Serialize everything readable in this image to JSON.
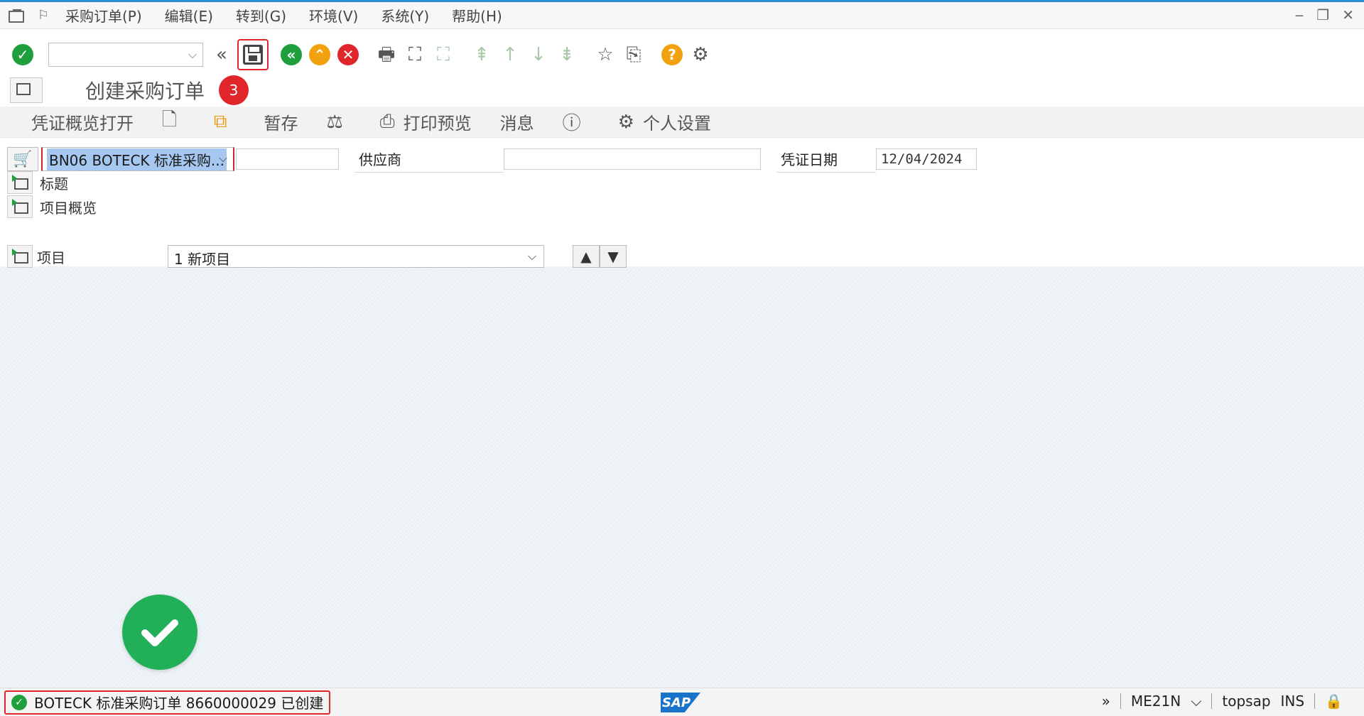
{
  "menu": {
    "items": [
      "采购订单(P)",
      "编辑(E)",
      "转到(G)",
      "环境(V)",
      "系统(Y)",
      "帮助(H)"
    ]
  },
  "title": {
    "text": "创建采购订单",
    "step_badge": "3"
  },
  "app_toolbar": {
    "doc_overview": "凭证概览打开",
    "hold": "暂存",
    "print_preview": "打印预览",
    "messages": "消息",
    "personal_settings": "个人设置"
  },
  "header": {
    "doc_type": "BN06 BOTECK 标准采购...",
    "vendor_label": "供应商",
    "vendor_value": "",
    "doc_date_label": "凭证日期",
    "doc_date_value": "12/04/2024"
  },
  "sections": {
    "header_label": "标题",
    "item_overview_label": "项目概览",
    "item_label": "项目",
    "item_value": "1 新项目"
  },
  "status": {
    "message": "BOTECK 标准采购订单 8660000029 已创建",
    "sap": "SAP",
    "tcode": "ME21N",
    "user": "topsap",
    "mode": "INS"
  }
}
